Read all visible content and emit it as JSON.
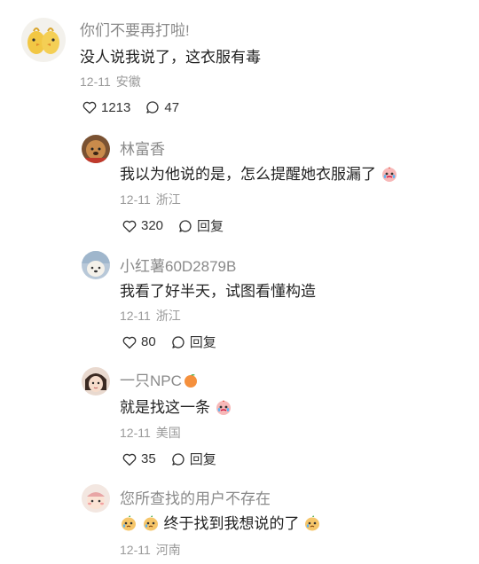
{
  "comments": [
    {
      "name": "你们不要再打啦!",
      "text": "没人说我说了，这衣服有毒",
      "date": "12-11",
      "location": "安徽",
      "likes": "1213",
      "replies": "47"
    },
    {
      "name": "林富香",
      "text": "我以为他说的是，怎么提醒她衣服漏了",
      "date": "12-11",
      "location": "浙江",
      "likes": "320",
      "reply_label": "回复"
    },
    {
      "name": "小红薯60D2879B",
      "text": "我看了好半天，试图看懂构造",
      "date": "12-11",
      "location": "浙江",
      "likes": "80",
      "reply_label": "回复"
    },
    {
      "name": "一只NPC",
      "text": "就是找这一条",
      "date": "12-11",
      "location": "美国",
      "likes": "35",
      "reply_label": "回复"
    },
    {
      "name": "您所查找的用户不存在",
      "text": "终于找到我想说的了",
      "date": "12-11",
      "location": "河南"
    }
  ],
  "colors": {
    "name": "#8a8a8a",
    "text": "#222222",
    "meta": "#9a9a9a"
  }
}
